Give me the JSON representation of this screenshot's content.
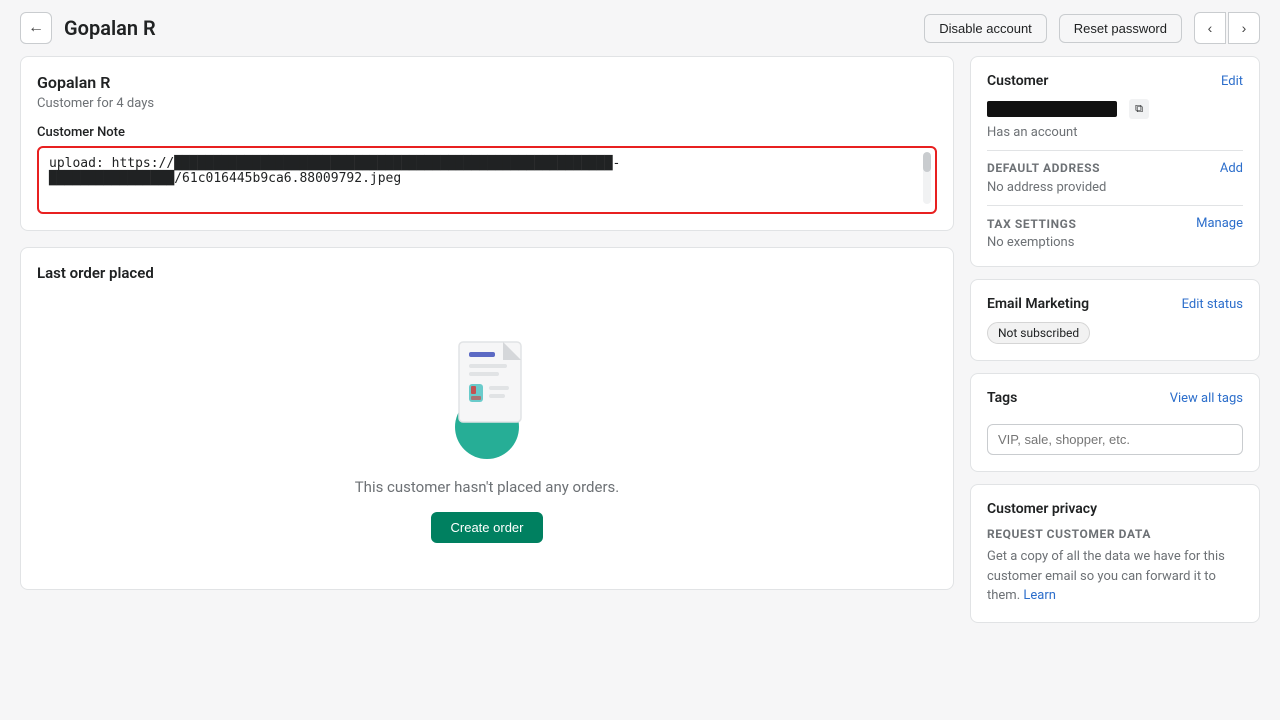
{
  "header": {
    "back_label": "←",
    "title": "Gopalan R",
    "disable_account": "Disable account",
    "reset_password": "Reset password",
    "prev_arrow": "‹",
    "next_arrow": "›"
  },
  "customer_card": {
    "name": "Gopalan R",
    "since": "Customer for 4 days",
    "note_label": "Customer Note",
    "note_content_line1": "upload: https://██████████████████████████████████████-",
    "note_content_line2": "██████████████/61c016445b9ca6.88009792.jpeg"
  },
  "last_order": {
    "title": "Last order placed",
    "empty_text": "This customer hasn't placed any orders.",
    "create_btn": "Create order"
  },
  "right_panel": {
    "customer_section": {
      "title": "Customer",
      "edit_label": "Edit",
      "email_placeholder": "████████████████",
      "copy_icon": "⧉",
      "has_account": "Has an account"
    },
    "default_address": {
      "label": "DEFAULT ADDRESS",
      "add_label": "Add",
      "value": "No address provided"
    },
    "tax_settings": {
      "label": "TAX SETTINGS",
      "manage_label": "Manage",
      "value": "No exemptions"
    },
    "email_marketing": {
      "title": "Email Marketing",
      "edit_status_label": "Edit status",
      "badge": "Not subscribed"
    },
    "tags": {
      "title": "Tags",
      "view_all_label": "View all tags",
      "input_placeholder": "VIP, sale, shopper, etc."
    },
    "customer_privacy": {
      "title": "Customer privacy",
      "request_label": "REQUEST CUSTOMER DATA",
      "request_text": "Get a copy of all the data we have for this customer email so you can forward it to them.",
      "learn_link": "Learn"
    }
  }
}
